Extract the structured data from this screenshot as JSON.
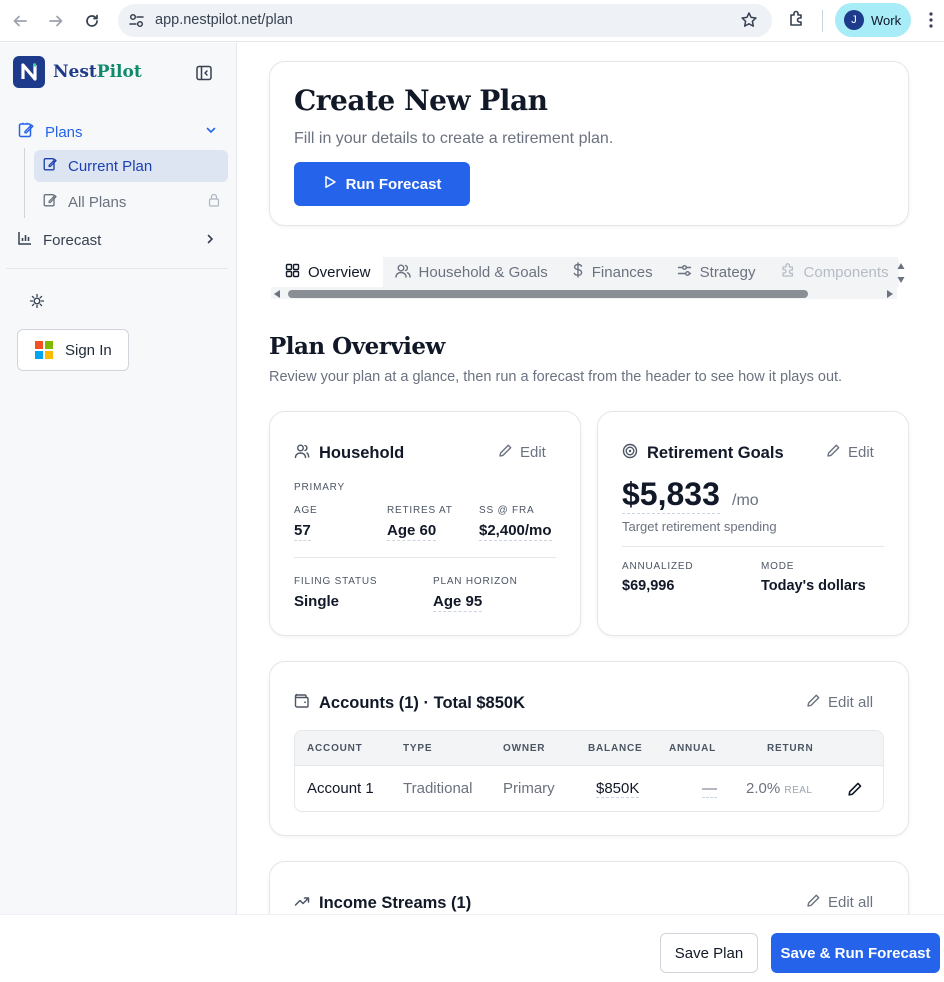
{
  "browser": {
    "url": "app.nestpilot.net/plan",
    "profile_initial": "J",
    "profile_label": "Work"
  },
  "sidebar": {
    "brand_left": "Nest",
    "brand_right": "Pilot",
    "plans_label": "Plans",
    "current_plan_label": "Current Plan",
    "all_plans_label": "All Plans",
    "forecast_label": "Forecast",
    "sign_in_label": "Sign In"
  },
  "hero": {
    "title": "Create New Plan",
    "subtitle": "Fill in your details to create a retirement plan.",
    "run_label": "Run Forecast"
  },
  "tabs": [
    {
      "label": "Overview",
      "icon": "grid-icon"
    },
    {
      "label": "Household & Goals",
      "icon": "users-icon"
    },
    {
      "label": "Finances",
      "icon": "dollar-icon"
    },
    {
      "label": "Strategy",
      "icon": "sliders-icon"
    },
    {
      "label": "Components",
      "icon": "puzzle-icon"
    }
  ],
  "overview": {
    "title": "Plan Overview",
    "subtitle": "Review your plan at a glance, then run a forecast from the header to see how it plays out."
  },
  "household": {
    "title": "Household",
    "edit_label": "Edit",
    "primary_label": "PRIMARY",
    "age_label": "AGE",
    "age_value": "57",
    "retires_label": "RETIRES AT",
    "retires_value": "Age 60",
    "ss_label": "SS @ FRA",
    "ss_value": "$2,400/mo",
    "filing_label": "FILING STATUS",
    "filing_value": "Single",
    "horizon_label": "PLAN HORIZON",
    "horizon_value": "Age 95"
  },
  "goals": {
    "title": "Retirement Goals",
    "edit_label": "Edit",
    "amount": "$5,833",
    "per": "/mo",
    "caption": "Target retirement spending",
    "annualized_label": "ANNUALIZED",
    "annualized_value": "$69,996",
    "mode_label": "MODE",
    "mode_value": "Today's dollars"
  },
  "accounts": {
    "title": "Accounts (1) · Total $850K",
    "edit_all_label": "Edit all",
    "columns": [
      "ACCOUNT",
      "TYPE",
      "OWNER",
      "BALANCE",
      "ANNUAL",
      "RETURN"
    ],
    "rows": [
      {
        "account": "Account 1",
        "type": "Traditional",
        "owner": "Primary",
        "balance": "$850K",
        "annual": "—",
        "return": "2.0%",
        "return_note": "REAL"
      }
    ]
  },
  "income": {
    "title": "Income Streams (1)",
    "edit_all_label": "Edit all"
  },
  "footer": {
    "save_label": "Save Plan",
    "save_run_label": "Save & Run Forecast"
  },
  "colors": {
    "accent": "#2563eb",
    "brand_navy": "#1e3a8a",
    "brand_green": "#0f8a6a"
  }
}
